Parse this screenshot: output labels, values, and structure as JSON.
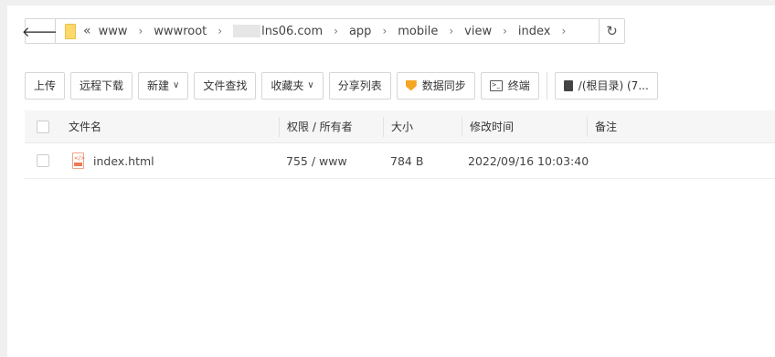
{
  "address_bar": {
    "crumbs": [
      "www",
      "wwwroot",
      "lns06.com",
      "app",
      "mobile",
      "view",
      "index"
    ]
  },
  "toolbar": {
    "upload": "上传",
    "remote_download": "远程下载",
    "new": "新建",
    "file_search": "文件查找",
    "favorites": "收藏夹",
    "share_list": "分享列表",
    "data_sync": "数据同步",
    "terminal": "终端",
    "root_dir": "/(根目录) (7..."
  },
  "table": {
    "headers": {
      "name": "文件名",
      "permissions": "权限 / 所有者",
      "size": "大小",
      "modified": "修改时间",
      "note": "备注"
    },
    "rows": [
      {
        "name": "index.html",
        "permissions": "755 / www",
        "size": "784 B",
        "modified": "2022/09/16 10:03:40",
        "note": ""
      }
    ]
  },
  "colors": {
    "folder": "#fbd96a",
    "sync_icon": "#f5a623",
    "file_icon": "#ee7a57"
  }
}
